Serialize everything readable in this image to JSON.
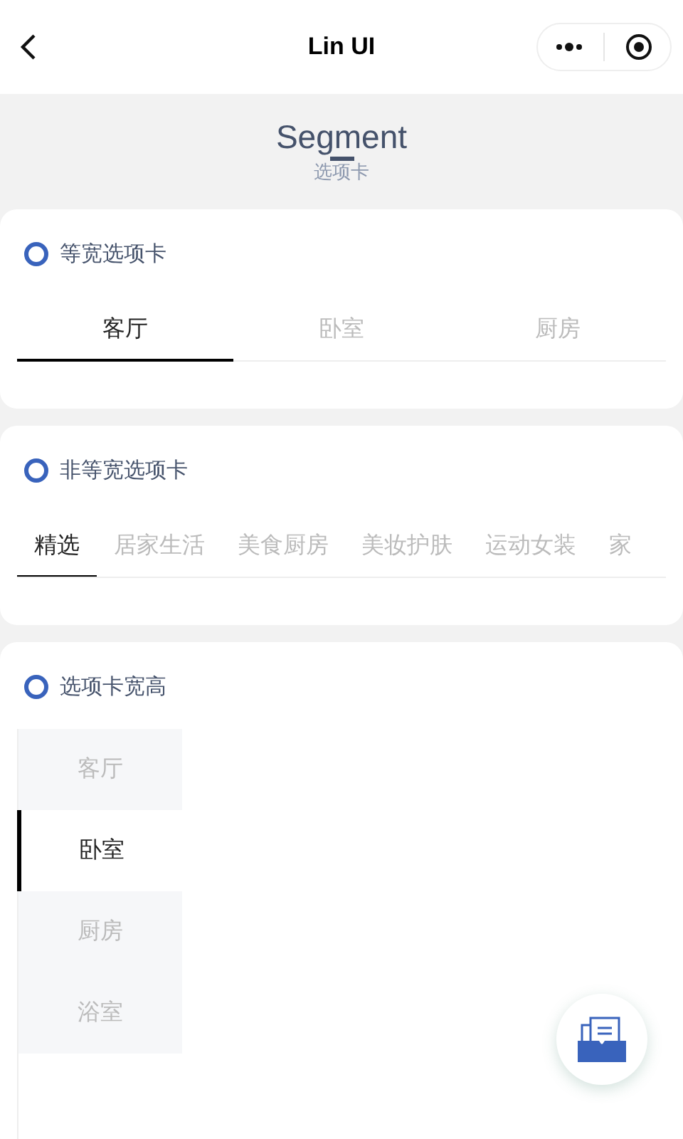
{
  "nav_bar": {
    "title": "Lin UI"
  },
  "header": {
    "title": "Segment",
    "subtitle": "选项卡"
  },
  "sections": [
    {
      "title": "等宽选项卡",
      "kind": "equal",
      "tabs": [
        {
          "label": "客厅",
          "selected": true
        },
        {
          "label": "卧室",
          "selected": false
        },
        {
          "label": "厨房",
          "selected": false
        }
      ]
    },
    {
      "title": "非等宽选项卡",
      "kind": "scroll",
      "tabs": [
        {
          "label": "精选",
          "selected": true
        },
        {
          "label": "居家生活",
          "selected": false
        },
        {
          "label": "美食厨房",
          "selected": false
        },
        {
          "label": "美妆护肤",
          "selected": false
        },
        {
          "label": "运动女装",
          "selected": false
        },
        {
          "label": "家",
          "selected": false
        }
      ]
    },
    {
      "title": "选项卡宽高",
      "kind": "vertical",
      "tabs": [
        {
          "label": "客厅",
          "selected": false
        },
        {
          "label": "卧室",
          "selected": true
        },
        {
          "label": "厨房",
          "selected": false
        },
        {
          "label": "浴室",
          "selected": false
        }
      ]
    }
  ]
}
